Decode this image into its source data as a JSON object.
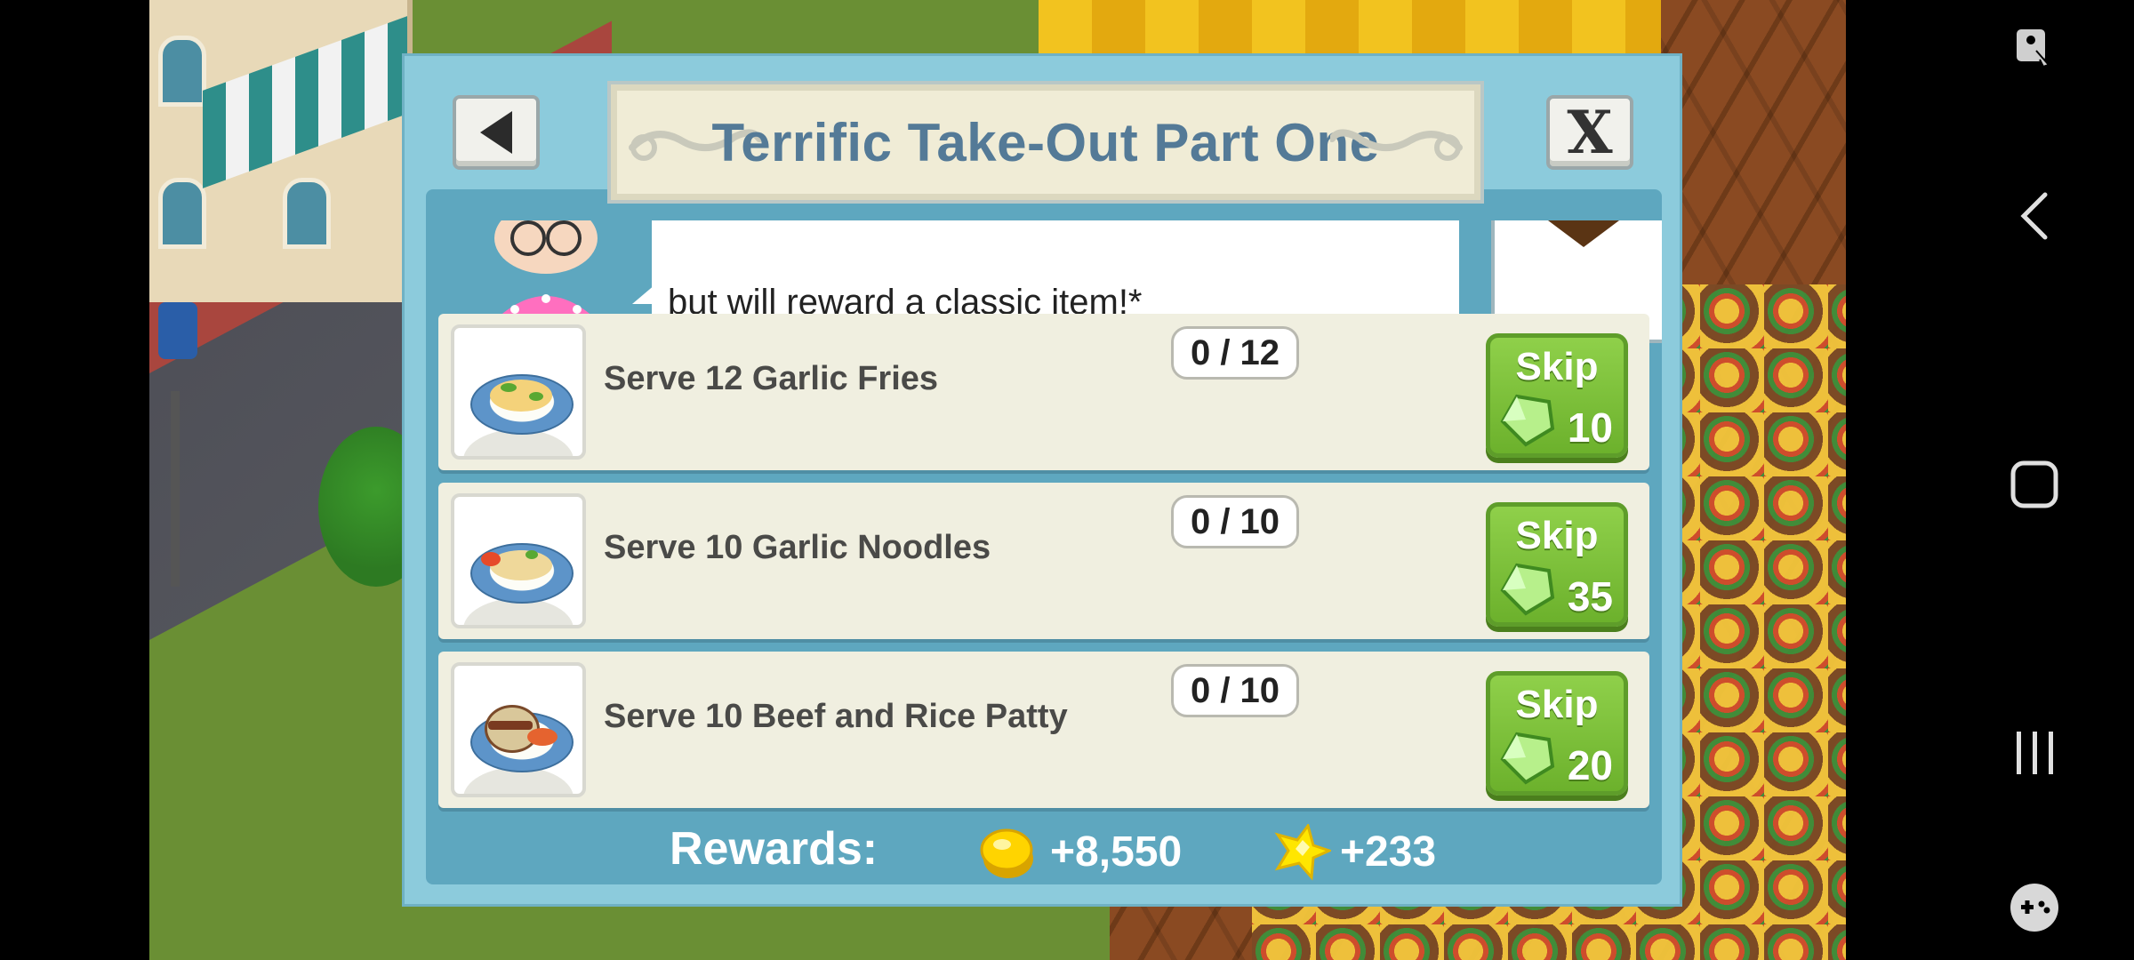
{
  "dialog": {
    "title": "Terrific Take-Out Part One",
    "close_label": "X",
    "story_text": "but will reward a classic item!*"
  },
  "tasks": [
    {
      "label": "Serve 12 Garlic Fries",
      "progress": "0 / 12",
      "skip_label": "Skip",
      "skip_cost": "10",
      "icon": "garlic-fries-icon"
    },
    {
      "label": "Serve 10 Garlic Noodles",
      "progress": "0 / 10",
      "skip_label": "Skip",
      "skip_cost": "35",
      "icon": "garlic-noodles-icon"
    },
    {
      "label": "Serve 10 Beef and Rice Patty",
      "progress": "0 / 10",
      "skip_label": "Skip",
      "skip_cost": "20",
      "icon": "beef-rice-patty-icon"
    }
  ],
  "rewards": {
    "label": "Rewards:",
    "coins": "+8,550",
    "xp": "+233"
  },
  "colors": {
    "dialog_bg": "#8ccbdc",
    "dialog_inner": "#5ea7bf",
    "title_text": "#547a97",
    "skip_green": "#7cc13b"
  },
  "nav": {
    "icons": [
      "accessibility-icon",
      "back-icon",
      "home-icon",
      "recents-icon",
      "game-tools-icon"
    ]
  }
}
